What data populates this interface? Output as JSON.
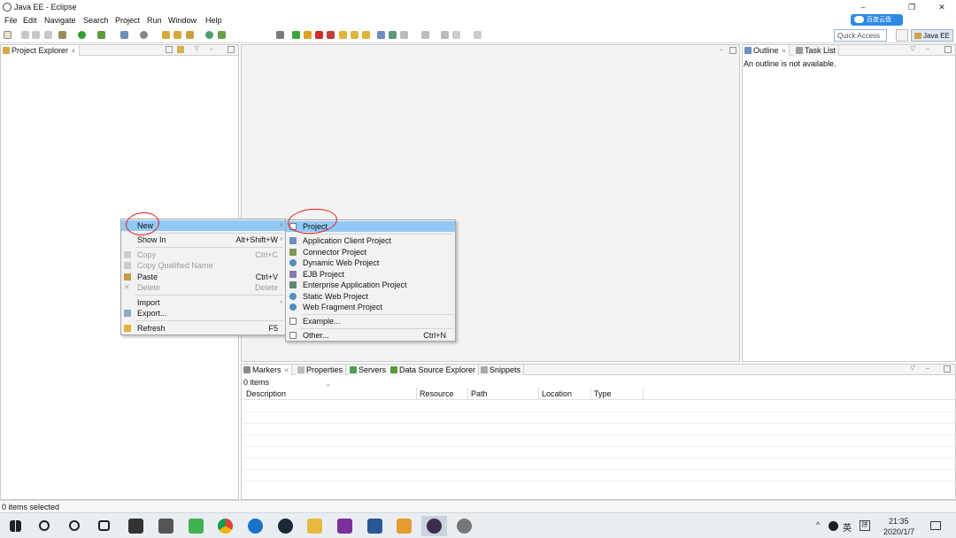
{
  "window": {
    "title": "Java EE - Eclipse",
    "minimize": "–",
    "maximize": "❐",
    "close": "✕"
  },
  "menubar": [
    "File",
    "Edit",
    "Navigate",
    "Search",
    "Project",
    "Run",
    "Window",
    "Help"
  ],
  "cloud_badge": "百度云盘",
  "toolbar": {
    "quick_access_placeholder": "Quick Access",
    "perspective": "Java EE"
  },
  "project_explorer": {
    "tab": "Project Explorer"
  },
  "outline": {
    "tabs": [
      "Outline",
      "Task List"
    ],
    "message": "An outline is not available."
  },
  "context_menu": {
    "items": [
      {
        "label": "New",
        "shortcut": "",
        "submenu": true,
        "highlight": true,
        "disabled": false
      },
      {
        "label": "Show In",
        "shortcut": "Alt+Shift+W",
        "submenu": true,
        "highlight": false,
        "disabled": false
      },
      {
        "label": "Copy",
        "shortcut": "Ctrl+C",
        "submenu": false,
        "highlight": false,
        "disabled": true
      },
      {
        "label": "Copy Qualified Name",
        "shortcut": "",
        "submenu": false,
        "highlight": false,
        "disabled": true
      },
      {
        "label": "Paste",
        "shortcut": "Ctrl+V",
        "submenu": false,
        "highlight": false,
        "disabled": false
      },
      {
        "label": "Delete",
        "shortcut": "Delete",
        "submenu": false,
        "highlight": false,
        "disabled": true
      },
      {
        "label": "Import",
        "shortcut": "",
        "submenu": true,
        "highlight": false,
        "disabled": false
      },
      {
        "label": "Export...",
        "shortcut": "",
        "submenu": false,
        "highlight": false,
        "disabled": false
      },
      {
        "label": "Refresh",
        "shortcut": "F5",
        "submenu": false,
        "highlight": false,
        "disabled": false
      }
    ]
  },
  "new_submenu": {
    "items": [
      {
        "label": "Project",
        "shortcut": ""
      },
      {
        "label": "Application Client Project",
        "shortcut": ""
      },
      {
        "label": "Connector Project",
        "shortcut": ""
      },
      {
        "label": "Dynamic Web Project",
        "shortcut": ""
      },
      {
        "label": "EJB Project",
        "shortcut": ""
      },
      {
        "label": "Enterprise Application Project",
        "shortcut": ""
      },
      {
        "label": "Static Web Project",
        "shortcut": ""
      },
      {
        "label": "Web Fragment Project",
        "shortcut": ""
      },
      {
        "label": "Example...",
        "shortcut": ""
      },
      {
        "label": "Other...",
        "shortcut": "Ctrl+N"
      }
    ]
  },
  "bottom_panel": {
    "tabs": [
      "Markers",
      "Properties",
      "Servers",
      "Data Source Explorer",
      "Snippets"
    ],
    "count": "0 items",
    "columns": [
      "Description",
      "Resource",
      "Path",
      "Location",
      "Type"
    ]
  },
  "statusbar": {
    "text": "0 items selected"
  },
  "taskbar": {
    "ime": "英",
    "ime2": "拼",
    "time": "21:35",
    "date": "2020/1/7",
    "tray_up": "^"
  }
}
